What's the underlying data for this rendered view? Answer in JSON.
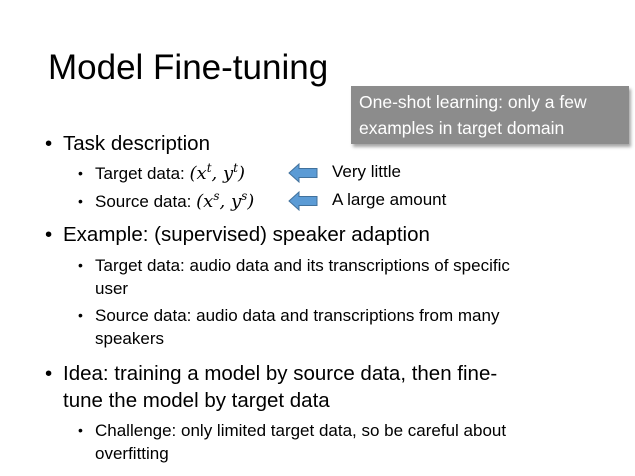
{
  "title": "Model Fine-tuning",
  "callout": {
    "line1": "One-shot learning: only a few",
    "line2": "examples in target domain"
  },
  "bullets": {
    "task": {
      "label": "Task description",
      "target_label": "Target data:",
      "target_expr": "(x",
      "target_sup1": "t",
      "target_mid": ", y",
      "target_sup2": "t",
      "target_end": ")",
      "target_note": "Very little",
      "source_label": "Source data:",
      "source_expr": "(x",
      "source_sup1": "s",
      "source_mid": ", y",
      "source_sup2": "s",
      "source_end": ")",
      "source_note": "A large amount"
    },
    "example": {
      "label": "Example: (supervised) speaker adaption",
      "sub1_line1": "Target data: audio data and its transcriptions of specific",
      "sub1_line2": "user",
      "sub2_line1": "Source data: audio data and transcriptions from many",
      "sub2_line2": "speakers"
    },
    "idea": {
      "line1": "Idea: training a model by source data, then fine-",
      "line2": "tune the model by target data",
      "sub1_line1": "Challenge: only limited target data, so be careful about",
      "sub1_line2": "overfitting"
    }
  },
  "colors": {
    "callout_bg": "#8c8c8c",
    "arrow_fill": "#5b9bd5",
    "arrow_stroke": "#41719c"
  },
  "icons": {
    "bullet_l1": "•",
    "bullet_l2": "•",
    "arrow": "left-arrow-icon"
  }
}
